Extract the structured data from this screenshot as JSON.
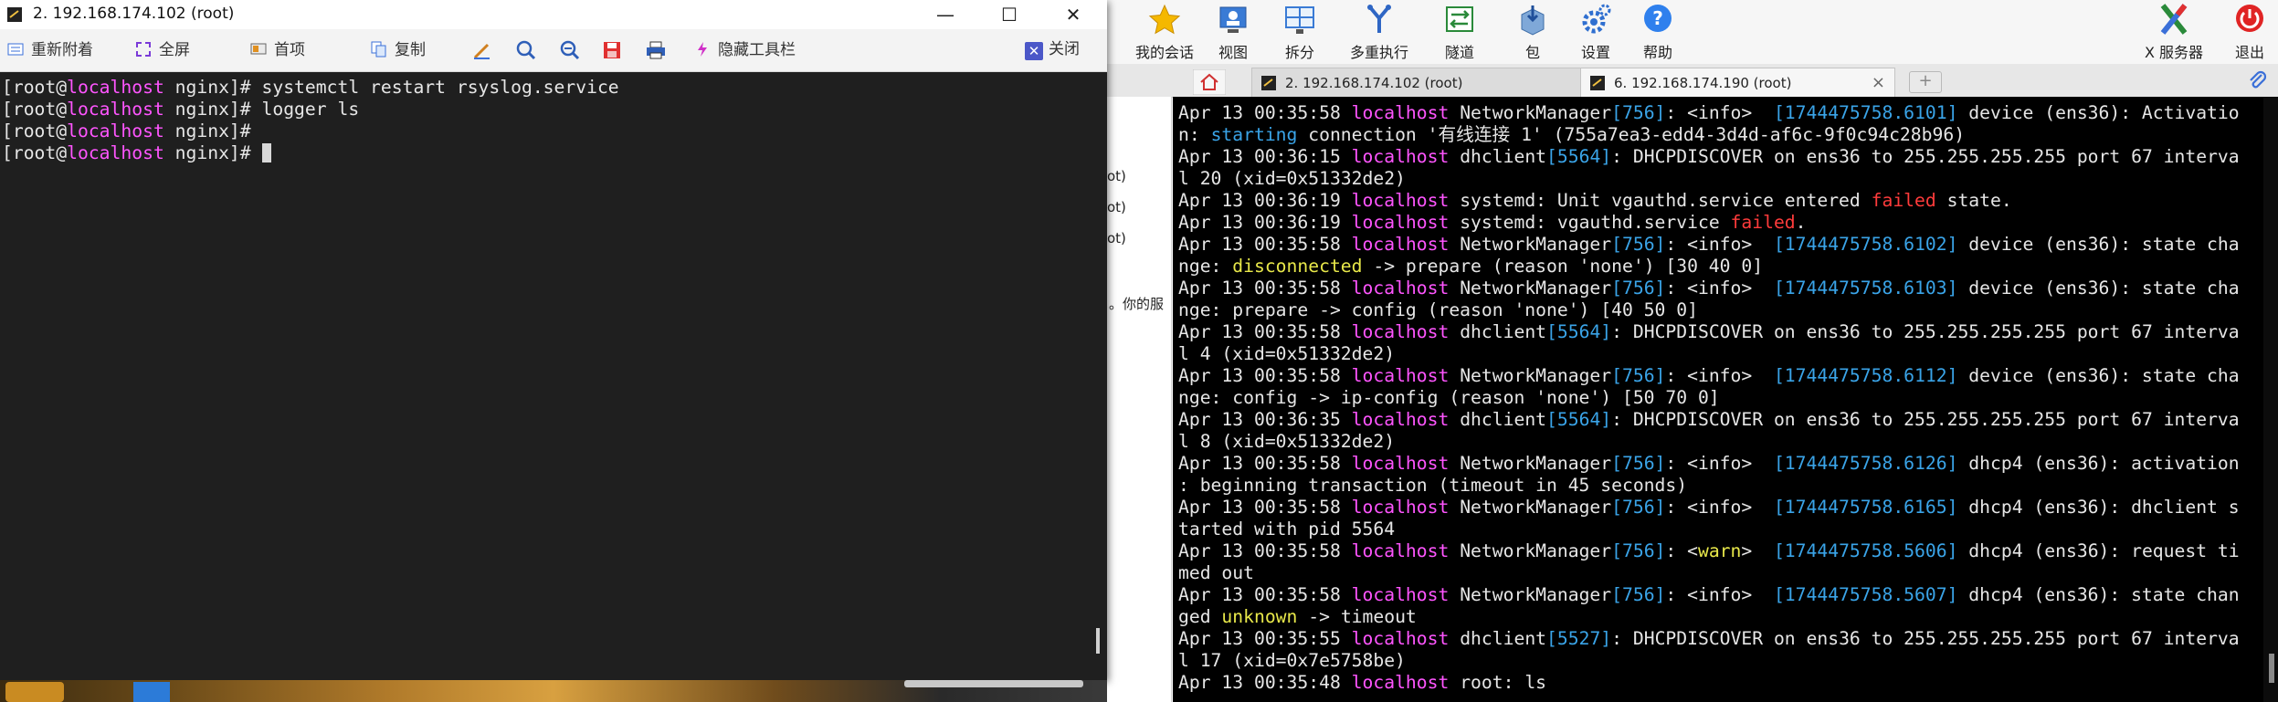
{
  "colors": {
    "host": "#ff55ff",
    "pid": "#3aa4e8",
    "failed": "#ff3b3b",
    "warn": "#e8e84a",
    "window_close": "#4b57c8"
  },
  "app_toolbar": {
    "items": [
      {
        "label": "我的会话",
        "icon": "star-icon"
      },
      {
        "label": "视图",
        "icon": "view-icon"
      },
      {
        "label": "拆分",
        "icon": "split-icon"
      },
      {
        "label": "多重执行",
        "icon": "multi-exec-icon"
      },
      {
        "label": "隧道",
        "icon": "tunnel-icon"
      },
      {
        "label": "包",
        "icon": "package-icon"
      },
      {
        "label": "设置",
        "icon": "gear-icon"
      },
      {
        "label": "帮助",
        "icon": "help-icon"
      },
      {
        "label": "X 服务器",
        "icon": "x-server-icon"
      },
      {
        "label": "退出",
        "icon": "power-icon"
      }
    ]
  },
  "tabs": [
    {
      "label": "2. 192.168.174.102 (root)"
    },
    {
      "label": "6. 192.168.174.190 (root)"
    }
  ],
  "side_fragments": [
    "ot)",
    "ot)",
    "ot)",
    "。你的服"
  ],
  "window": {
    "title": "2. 192.168.174.102 (root)",
    "toolbar": {
      "reconnect": "重新附着",
      "fullscreen": "全屏",
      "options": "首项",
      "copy": "复制",
      "hide_toolbar": "隐藏工具栏",
      "close": "关闭"
    }
  },
  "left_terminal": {
    "lines": [
      {
        "user": "[root@",
        "host": "localhost",
        "rest": " nginx]# ",
        "cmd": "systemctl restart rsyslog.service"
      },
      {
        "user": "[root@",
        "host": "localhost",
        "rest": " nginx]# ",
        "cmd": "logger ls"
      },
      {
        "user": "[root@",
        "host": "localhost",
        "rest": " nginx]# ",
        "cmd": ""
      },
      {
        "user": "[root@",
        "host": "localhost",
        "rest": " nginx]# ",
        "cmd": ""
      }
    ]
  },
  "right_terminal": {
    "lines": [
      [
        [
          "Apr 13 00:35:58 ",
          ""
        ],
        [
          "localhost",
          "host"
        ],
        [
          " NetworkManager",
          ""
        ],
        [
          "[756]",
          "pid"
        ],
        [
          ": <info>  ",
          ""
        ],
        [
          "[1744475758.6101]",
          "ts"
        ],
        [
          " device (ens36): Activatio",
          ""
        ]
      ],
      [
        [
          "n: ",
          ""
        ],
        [
          "starting",
          "str"
        ],
        [
          " connection '有线连接 1' (755a7ea3-edd4-3d4d-af6c-9f0c94c28b96)",
          ""
        ]
      ],
      [
        [
          "Apr 13 00:36:15 ",
          ""
        ],
        [
          "localhost",
          "host"
        ],
        [
          " dhclient",
          ""
        ],
        [
          "[5564]",
          "pid"
        ],
        [
          ": DHCPDISCOVER on ens36 to 255.255.255.255 port 67 interva",
          ""
        ]
      ],
      [
        [
          "l 20 (xid=0x51332de2)",
          ""
        ]
      ],
      [
        [
          "Apr 13 00:36:19 ",
          ""
        ],
        [
          "localhost",
          "host"
        ],
        [
          " systemd: Unit vgauthd.service entered ",
          ""
        ],
        [
          "failed",
          "red"
        ],
        [
          " state.",
          ""
        ]
      ],
      [
        [
          "Apr 13 00:36:19 ",
          ""
        ],
        [
          "localhost",
          "host"
        ],
        [
          " systemd: vgauthd.service ",
          ""
        ],
        [
          "failed",
          "red"
        ],
        [
          ".",
          ""
        ]
      ],
      [
        [
          "Apr 13 00:35:58 ",
          ""
        ],
        [
          "localhost",
          "host"
        ],
        [
          " NetworkManager",
          ""
        ],
        [
          "[756]",
          "pid"
        ],
        [
          ": <info>  ",
          ""
        ],
        [
          "[1744475758.6102]",
          "ts"
        ],
        [
          " device (ens36): state cha",
          ""
        ]
      ],
      [
        [
          "nge: ",
          ""
        ],
        [
          "disconnected",
          "yel"
        ],
        [
          " -> prepare (reason 'none') [30 40 0]",
          ""
        ]
      ],
      [
        [
          "Apr 13 00:35:58 ",
          ""
        ],
        [
          "localhost",
          "host"
        ],
        [
          " NetworkManager",
          ""
        ],
        [
          "[756]",
          "pid"
        ],
        [
          ": <info>  ",
          ""
        ],
        [
          "[1744475758.6103]",
          "ts"
        ],
        [
          " device (ens36): state cha",
          ""
        ]
      ],
      [
        [
          "nge: prepare -> config (reason 'none') [40 50 0]",
          ""
        ]
      ],
      [
        [
          "Apr 13 00:35:58 ",
          ""
        ],
        [
          "localhost",
          "host"
        ],
        [
          " dhclient",
          ""
        ],
        [
          "[5564]",
          "pid"
        ],
        [
          ": DHCPDISCOVER on ens36 to 255.255.255.255 port 67 interva",
          ""
        ]
      ],
      [
        [
          "l 4 (xid=0x51332de2)",
          ""
        ]
      ],
      [
        [
          "Apr 13 00:35:58 ",
          ""
        ],
        [
          "localhost",
          "host"
        ],
        [
          " NetworkManager",
          ""
        ],
        [
          "[756]",
          "pid"
        ],
        [
          ": <info>  ",
          ""
        ],
        [
          "[1744475758.6112]",
          "ts"
        ],
        [
          " device (ens36): state cha",
          ""
        ]
      ],
      [
        [
          "nge: config -> ip-config (reason 'none') [50 70 0]",
          ""
        ]
      ],
      [
        [
          "Apr 13 00:36:35 ",
          ""
        ],
        [
          "localhost",
          "host"
        ],
        [
          " dhclient",
          ""
        ],
        [
          "[5564]",
          "pid"
        ],
        [
          ": DHCPDISCOVER on ens36 to 255.255.255.255 port 67 interva",
          ""
        ]
      ],
      [
        [
          "l 8 (xid=0x51332de2)",
          ""
        ]
      ],
      [
        [
          "Apr 13 00:35:58 ",
          ""
        ],
        [
          "localhost",
          "host"
        ],
        [
          " NetworkManager",
          ""
        ],
        [
          "[756]",
          "pid"
        ],
        [
          ": <info>  ",
          ""
        ],
        [
          "[1744475758.6126]",
          "ts"
        ],
        [
          " dhcp4 (ens36): activation",
          ""
        ]
      ],
      [
        [
          ": beginning transaction (timeout in 45 seconds)",
          ""
        ]
      ],
      [
        [
          "Apr 13 00:35:58 ",
          ""
        ],
        [
          "localhost",
          "host"
        ],
        [
          " NetworkManager",
          ""
        ],
        [
          "[756]",
          "pid"
        ],
        [
          ": <info>  ",
          ""
        ],
        [
          "[1744475758.6165]",
          "ts"
        ],
        [
          " dhcp4 (ens36): dhclient s",
          ""
        ]
      ],
      [
        [
          "tarted with pid 5564",
          ""
        ]
      ],
      [
        [
          "Apr 13 00:35:58 ",
          ""
        ],
        [
          "localhost",
          "host"
        ],
        [
          " NetworkManager",
          ""
        ],
        [
          "[756]",
          "pid"
        ],
        [
          ": <",
          ""
        ],
        [
          "warn",
          "yel"
        ],
        [
          ">  ",
          ""
        ],
        [
          "[1744475758.5606]",
          "ts"
        ],
        [
          " dhcp4 (ens36): request ti",
          ""
        ]
      ],
      [
        [
          "med out",
          ""
        ]
      ],
      [
        [
          "Apr 13 00:35:58 ",
          ""
        ],
        [
          "localhost",
          "host"
        ],
        [
          " NetworkManager",
          ""
        ],
        [
          "[756]",
          "pid"
        ],
        [
          ": <info>  ",
          ""
        ],
        [
          "[1744475758.5607]",
          "ts"
        ],
        [
          " dhcp4 (ens36): state chan",
          ""
        ]
      ],
      [
        [
          "ged ",
          ""
        ],
        [
          "unknown",
          "yel"
        ],
        [
          " -> timeout",
          ""
        ]
      ],
      [
        [
          "Apr 13 00:35:55 ",
          ""
        ],
        [
          "localhost",
          "host"
        ],
        [
          " dhclient",
          ""
        ],
        [
          "[5527]",
          "pid"
        ],
        [
          ": DHCPDISCOVER on ens36 to 255.255.255.255 port 67 interva",
          ""
        ]
      ],
      [
        [
          "l 17 (xid=0x7e5758be)",
          ""
        ]
      ],
      [
        [
          "Apr 13 00:35:48 ",
          ""
        ],
        [
          "localhost",
          "host"
        ],
        [
          " root: ls",
          ""
        ]
      ]
    ]
  }
}
